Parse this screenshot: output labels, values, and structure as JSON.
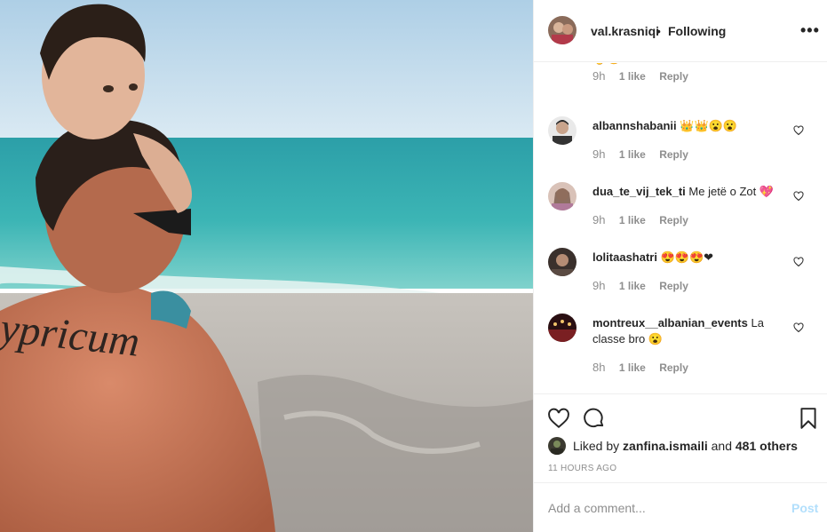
{
  "header": {
    "username": "val.krasniqi",
    "separator": "•",
    "follow_status": "Following",
    "more_label": "•••"
  },
  "comments": [
    {
      "username": "",
      "text": "✌😍",
      "time": "9h",
      "likes": "1 like",
      "reply": "Reply",
      "partially_hidden": true
    },
    {
      "username": "albannshabanii",
      "text": "👑👑😮😮",
      "time": "9h",
      "likes": "1 like",
      "reply": "Reply"
    },
    {
      "username": "dua_te_vij_tek_ti",
      "text": "Me jetë o Zot 💖",
      "time": "9h",
      "likes": "1 like",
      "reply": "Reply"
    },
    {
      "username": "lolitaashatri",
      "text": "😍😍😍❤",
      "time": "9h",
      "likes": "1 like",
      "reply": "Reply"
    },
    {
      "username": "montreux__albanian_events",
      "text": "La classe bro 😮",
      "time": "8h",
      "likes": "1 like",
      "reply": "Reply"
    }
  ],
  "actions": {
    "like_icon": "heart-outline-icon",
    "comment_icon": "speech-bubble-icon",
    "save_icon": "bookmark-icon"
  },
  "likes_summary": {
    "prefix": "Liked by",
    "user": "zanfina.ismaili",
    "connector": "and",
    "others": "481 others"
  },
  "timestamp": "11 HOURS AGO",
  "add_comment": {
    "placeholder": "Add a comment...",
    "post_label": "Post"
  },
  "colors": {
    "text": "#262626",
    "muted": "#8e8e8e",
    "divider": "#efefef",
    "post_disabled": "#b2dffc"
  }
}
